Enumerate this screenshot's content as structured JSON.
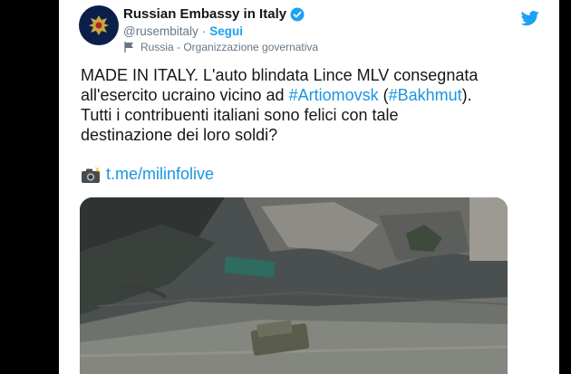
{
  "tweet": {
    "author": {
      "display_name": "Russian Embassy in Italy",
      "handle": "@rusembitaly",
      "separator": "·",
      "follow_label": "Segui",
      "account_label": "Russia - Organizzazione governativa"
    },
    "text": {
      "line1": "MADE IN ITALY. L'auto blindata Lince MLV consegnata",
      "line2_before": "all'esercito ucraino vicino ad ",
      "hashtag1": "#Artiomovsk",
      "line2_mid": " (",
      "hashtag2": "#Bakhmut",
      "line2_after": ").",
      "line3": "Tutti i contribuenti italiani sono felici con tale",
      "line4": "destinazione dei loro soldi?"
    },
    "link": {
      "icon": "camera-flash-icon",
      "text": "t.me/milinfolive"
    },
    "media": {
      "description_icon": "aerial-photo"
    }
  },
  "colors": {
    "accent": "#1da1f2",
    "link": "#1b95e0",
    "text": "#14171a",
    "secondary": "#657786"
  }
}
